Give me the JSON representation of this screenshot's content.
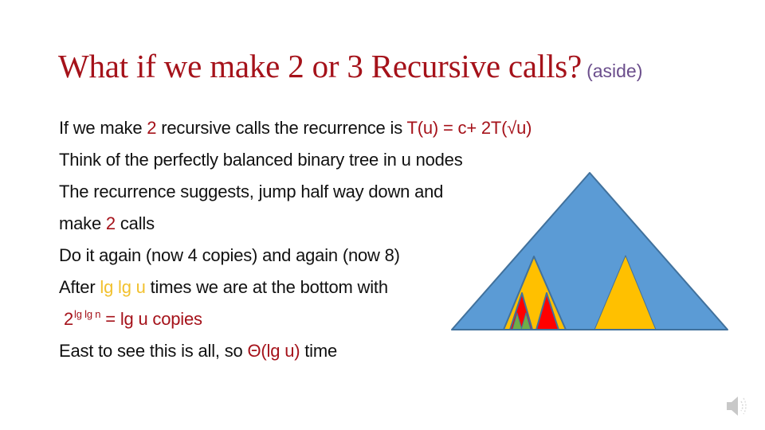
{
  "slide": {
    "title": {
      "text": "What if we make 2 or 3 Recursive calls?",
      "aside": "(aside)"
    },
    "lines": [
      {
        "segments": [
          {
            "text": "If we make ",
            "style": "normal"
          },
          {
            "text": "2",
            "style": "red"
          },
          {
            "text": " recursive calls the recurrence is ",
            "style": "normal"
          },
          {
            "text": "T(u) = c+ 2T(√u)",
            "style": "red"
          }
        ]
      },
      {
        "segments": [
          {
            "text": "Think of the perfectly balanced binary tree in u nodes",
            "style": "normal"
          }
        ]
      },
      {
        "segments": [
          {
            "text": "The recurrence suggests, jump half way down and",
            "style": "normal"
          }
        ]
      },
      {
        "segments": [
          {
            "text": "make ",
            "style": "normal"
          },
          {
            "text": "2",
            "style": "red"
          },
          {
            "text": " calls",
            "style": "normal"
          }
        ]
      },
      {
        "segments": [
          {
            "text": "Do it again (now 4 copies) and again (now 8)",
            "style": "normal"
          }
        ]
      },
      {
        "segments": [
          {
            "text": "After ",
            "style": "normal"
          },
          {
            "text": "lg lg u",
            "style": "gold"
          },
          {
            "text": " times we are at the bottom with",
            "style": "normal"
          }
        ]
      },
      {
        "segments": [
          {
            "text": "2",
            "style": "red"
          },
          {
            "text": "lg lg n",
            "style": "red-sup"
          },
          {
            "text": " = lg u copies",
            "style": "red"
          }
        ]
      },
      {
        "segments": [
          {
            "text": "East to see this is all, so ",
            "style": "normal"
          },
          {
            "text": "Θ(lg u)",
            "style": "red"
          },
          {
            "text": " time",
            "style": "normal"
          }
        ]
      }
    ],
    "diagram": {
      "description": "Perfectly balanced binary tree drawn as nested triangles",
      "colors": {
        "tree": "#5B9BD5",
        "outline": "#41719C",
        "level1": "#FFC000",
        "level2": "#FF0000",
        "level3": "#70AD47"
      },
      "levels": [
        {
          "name": "full-tree",
          "count": 1,
          "color_key": "tree"
        },
        {
          "name": "half-depth-subtrees",
          "count": 2,
          "color_key": "level1"
        },
        {
          "name": "quarter-depth-subtrees",
          "count": 2,
          "color_key": "level2"
        },
        {
          "name": "eighth-depth-subtrees",
          "count": 2,
          "color_key": "level3"
        }
      ]
    },
    "audio_icon": "speaker-icon"
  }
}
